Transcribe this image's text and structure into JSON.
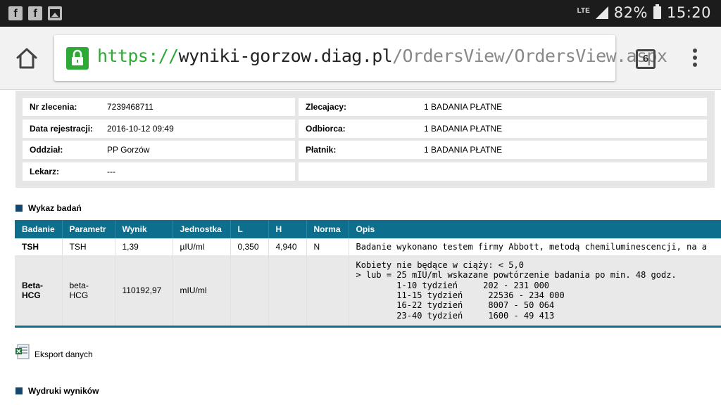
{
  "status_bar": {
    "left_icons": [
      "facebook-icon",
      "facebook-icon",
      "image-icon"
    ],
    "network": "LTE",
    "battery_percent": "82%",
    "time": "15:20"
  },
  "browser": {
    "url_scheme": "https://",
    "url_host": "wyniki-gorzow.diag.pl",
    "url_path": "/OrdersView/OrdersView.aspx",
    "tab_count": "6"
  },
  "order": {
    "left": [
      {
        "label": "Nr zlecenia:",
        "value": "7239468711"
      },
      {
        "label": "Data rejestracji:",
        "value": "2016-10-12 09:49"
      },
      {
        "label": "Oddział:",
        "value": "PP Gorzów"
      },
      {
        "label": "Lekarz:",
        "value": "---"
      }
    ],
    "right": [
      {
        "label": "Zlecajacy:",
        "value": "1 BADANIA PŁATNE"
      },
      {
        "label": "Odbiorca:",
        "value": "1 BADANIA PŁATNE"
      },
      {
        "label": "Płatnik:",
        "value": "1 BADANIA PŁATNE"
      }
    ]
  },
  "results_section": {
    "title": "Wykaz badań",
    "columns": [
      "Badanie",
      "Parametr",
      "Wynik",
      "Jednostka",
      "L",
      "H",
      "Norma",
      "Opis"
    ],
    "rows": [
      {
        "badanie": "TSH",
        "parametr": "TSH",
        "wynik": "1,39",
        "jednostka": "µIU/ml",
        "l": "0,350",
        "h": "4,940",
        "norma": "N",
        "opis": "Badanie wykonano testem firmy Abbott, metodą chemiluminescencji, na a"
      },
      {
        "badanie": "Beta-HCG",
        "parametr": "beta-HCG",
        "wynik": "110192,97",
        "jednostka": "mIU/ml",
        "l": "",
        "h": "",
        "norma": "",
        "opis": "Kobiety nie będące w ciąży: < 5,0\n> lub = 25 mIU/ml wskazane powtórzenie badania po min. 48 godz.\n        1-10 tydzień     202 - 231 000\n        11-15 tydzień     22536 - 234 000\n        16-22 tydzień     8007 - 50 064\n        23-40 tydzień     1600 - 49 413"
      }
    ]
  },
  "export": {
    "label": "Eksport danych"
  },
  "printouts_section": {
    "title": "Wydruki wyników"
  },
  "colors": {
    "table_header": "#0e6e8e",
    "section_square": "#14466e",
    "secure_green": "#2fa935"
  }
}
